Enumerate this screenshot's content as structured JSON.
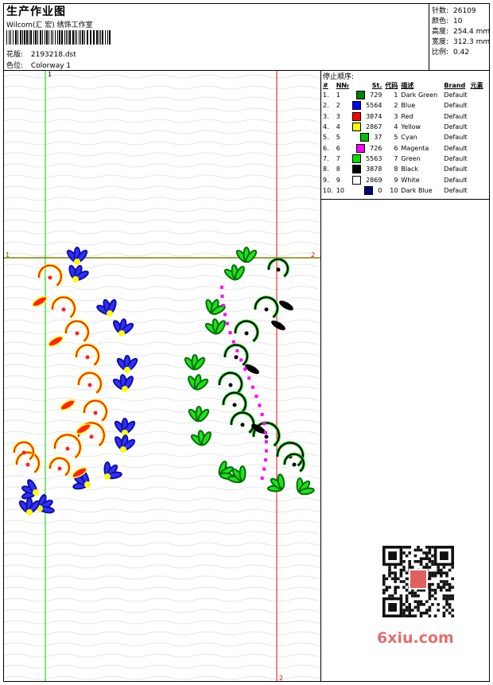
{
  "header": {
    "title": "生产作业图",
    "company": "Wilcom(汇 宏) 绣饰工作室",
    "pattern_label": "花版:",
    "pattern_value": "2193218.dst",
    "color_label": "色位:",
    "color_value": "Colorway 1"
  },
  "stats": {
    "stitches_label": "针数:",
    "stitches_value": "26109",
    "colors_label": "颜色:",
    "colors_value": "10",
    "height_label": "高度:",
    "height_value": "254.4 mm",
    "width_label": "宽度:",
    "width_value": "312.3 mm",
    "ratio_label": "比例:",
    "ratio_value": "0.42"
  },
  "stop_sequence": {
    "heading": "停止顺序:",
    "columns": [
      "#",
      "N№",
      "St.",
      "代码",
      "描述",
      "Brand",
      "元素"
    ],
    "rows": [
      {
        "idx": "1.",
        "n": "1",
        "st": "729",
        "code": "1",
        "desc": "Dark Green",
        "brand": "Default",
        "color": "#008000"
      },
      {
        "idx": "2.",
        "n": "2",
        "st": "5564",
        "code": "2",
        "desc": "Blue",
        "brand": "Default",
        "color": "#0000ff"
      },
      {
        "idx": "3.",
        "n": "3",
        "st": "3874",
        "code": "3",
        "desc": "Red",
        "brand": "Default",
        "color": "#ff0000"
      },
      {
        "idx": "4.",
        "n": "4",
        "st": "2867",
        "code": "4",
        "desc": "Yellow",
        "brand": "Default",
        "color": "#ffff00"
      },
      {
        "idx": "5.",
        "n": "5",
        "st": "37",
        "code": "5",
        "desc": "Cyan",
        "brand": "Default",
        "color": "#00c000"
      },
      {
        "idx": "6.",
        "n": "6",
        "st": "726",
        "code": "6",
        "desc": "Magenta",
        "brand": "Default",
        "color": "#ff00ff"
      },
      {
        "idx": "7.",
        "n": "7",
        "st": "5563",
        "code": "7",
        "desc": "Green",
        "brand": "Default",
        "color": "#00e000"
      },
      {
        "idx": "8.",
        "n": "8",
        "st": "3878",
        "code": "8",
        "desc": "Black",
        "brand": "Default",
        "color": "#000000"
      },
      {
        "idx": "9.",
        "n": "9",
        "st": "2869",
        "code": "9",
        "desc": "White",
        "brand": "Default",
        "color": "#ffffff"
      },
      {
        "idx": "10.",
        "n": "10",
        "st": "0",
        "code": "10",
        "desc": "Dark Blue",
        "brand": "Default",
        "color": "#000080"
      }
    ]
  },
  "guides": {
    "v1_label": "1",
    "v2_label": "2",
    "h1_label_left": "1",
    "h1_label_right": "2",
    "bottom_label": "2"
  },
  "watermark": {
    "text": "6xiu.com"
  },
  "colors": {
    "guide_green": "#00cc00",
    "guide_red": "#ff0000",
    "guide_olive": "#808000"
  }
}
